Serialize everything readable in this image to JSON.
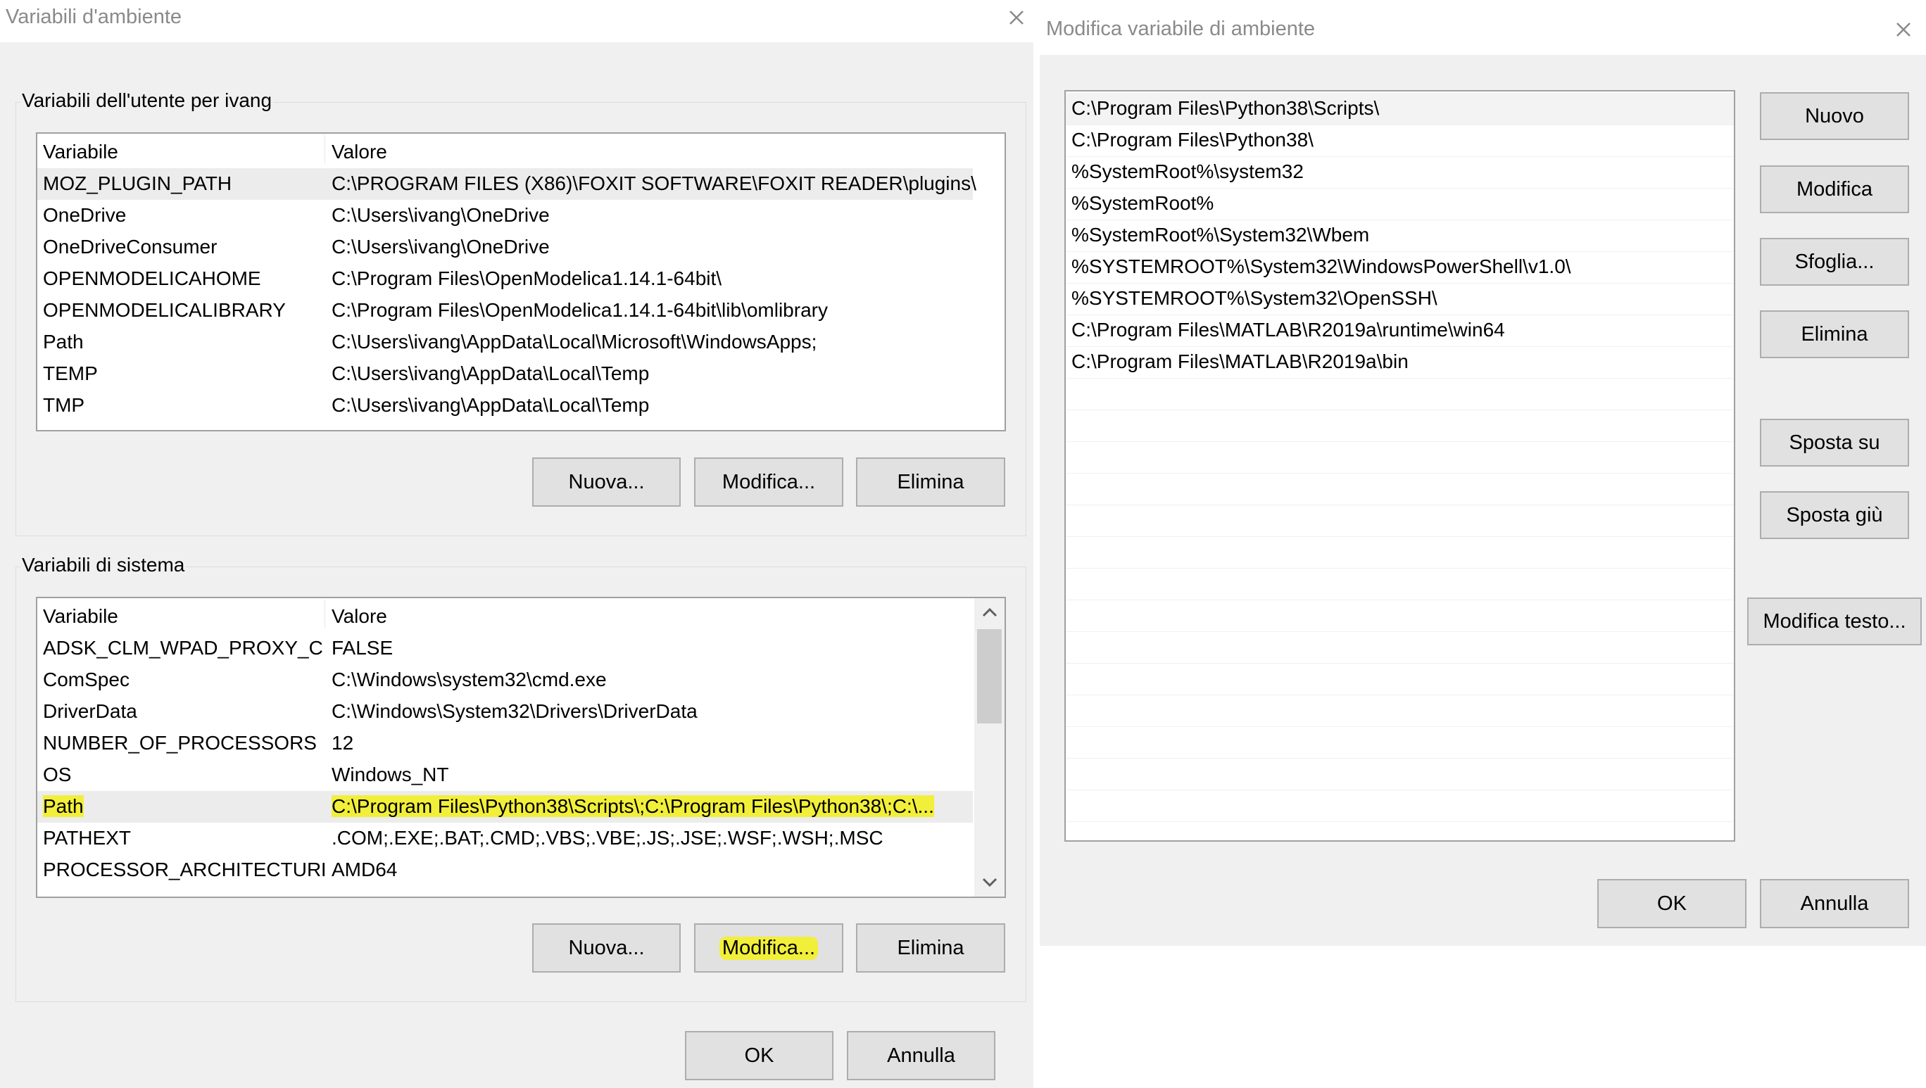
{
  "left_dialog": {
    "title": "Variabili d'ambiente",
    "user_group_label": "Variabili dell'utente per ivang",
    "user_vars": {
      "headers": [
        "Variabile",
        "Valore"
      ],
      "rows": [
        {
          "name": "MOZ_PLUGIN_PATH",
          "value": "C:\\PROGRAM FILES (X86)\\FOXIT SOFTWARE\\FOXIT READER\\plugins\\"
        },
        {
          "name": "OneDrive",
          "value": "C:\\Users\\ivang\\OneDrive"
        },
        {
          "name": "OneDriveConsumer",
          "value": "C:\\Users\\ivang\\OneDrive"
        },
        {
          "name": "OPENMODELICAHOME",
          "value": "C:\\Program Files\\OpenModelica1.14.1-64bit\\"
        },
        {
          "name": "OPENMODELICALIBRARY",
          "value": "C:\\Program Files\\OpenModelica1.14.1-64bit\\lib\\omlibrary"
        },
        {
          "name": "Path",
          "value": "C:\\Users\\ivang\\AppData\\Local\\Microsoft\\WindowsApps;"
        },
        {
          "name": "TEMP",
          "value": "C:\\Users\\ivang\\AppData\\Local\\Temp"
        },
        {
          "name": "TMP",
          "value": "C:\\Users\\ivang\\AppData\\Local\\Temp"
        }
      ]
    },
    "user_buttons": {
      "new": "Nuova...",
      "edit": "Modifica...",
      "delete": "Elimina"
    },
    "system_group_label": "Variabili di sistema",
    "system_vars": {
      "headers": [
        "Variabile",
        "Valore"
      ],
      "rows": [
        {
          "name": "ADSK_CLM_WPAD_PROXY_C...",
          "value": "FALSE"
        },
        {
          "name": "ComSpec",
          "value": "C:\\Windows\\system32\\cmd.exe"
        },
        {
          "name": "DriverData",
          "value": "C:\\Windows\\System32\\Drivers\\DriverData"
        },
        {
          "name": "NUMBER_OF_PROCESSORS",
          "value": "12"
        },
        {
          "name": "OS",
          "value": "Windows_NT"
        },
        {
          "name": "Path",
          "value": "C:\\Program Files\\Python38\\Scripts\\;C:\\Program Files\\Python38\\;C:\\..."
        },
        {
          "name": "PATHEXT",
          "value": ".COM;.EXE;.BAT;.CMD;.VBS;.VBE;.JS;.JSE;.WSF;.WSH;.MSC"
        },
        {
          "name": "PROCESSOR_ARCHITECTURE",
          "value": "AMD64"
        }
      ]
    },
    "system_buttons": {
      "new": "Nuova...",
      "edit": "Modifica...",
      "delete": "Elimina"
    },
    "ok": "OK",
    "cancel": "Annulla"
  },
  "right_dialog": {
    "title": "Modifica variabile di ambiente",
    "entries": [
      "C:\\Program Files\\Python38\\Scripts\\",
      "C:\\Program Files\\Python38\\",
      "%SystemRoot%\\system32",
      "%SystemRoot%",
      "%SystemRoot%\\System32\\Wbem",
      "%SYSTEMROOT%\\System32\\WindowsPowerShell\\v1.0\\",
      "%SYSTEMROOT%\\System32\\OpenSSH\\",
      "C:\\Program Files\\MATLAB\\R2019a\\runtime\\win64",
      "C:\\Program Files\\MATLAB\\R2019a\\bin"
    ],
    "buttons": {
      "new": "Nuovo",
      "edit": "Modifica",
      "browse": "Sfoglia...",
      "delete": "Elimina",
      "move_up": "Sposta su",
      "move_down": "Sposta giù",
      "edit_text": "Modifica testo..."
    },
    "ok": "OK",
    "cancel": "Annulla"
  },
  "colors": {
    "highlight": "#f2ef3a",
    "dialog_bg": "#f0f0f0",
    "button_bg": "#e1e1e1"
  },
  "icons": [
    "close-icon",
    "scroll-up-icon",
    "scroll-down-icon"
  ]
}
